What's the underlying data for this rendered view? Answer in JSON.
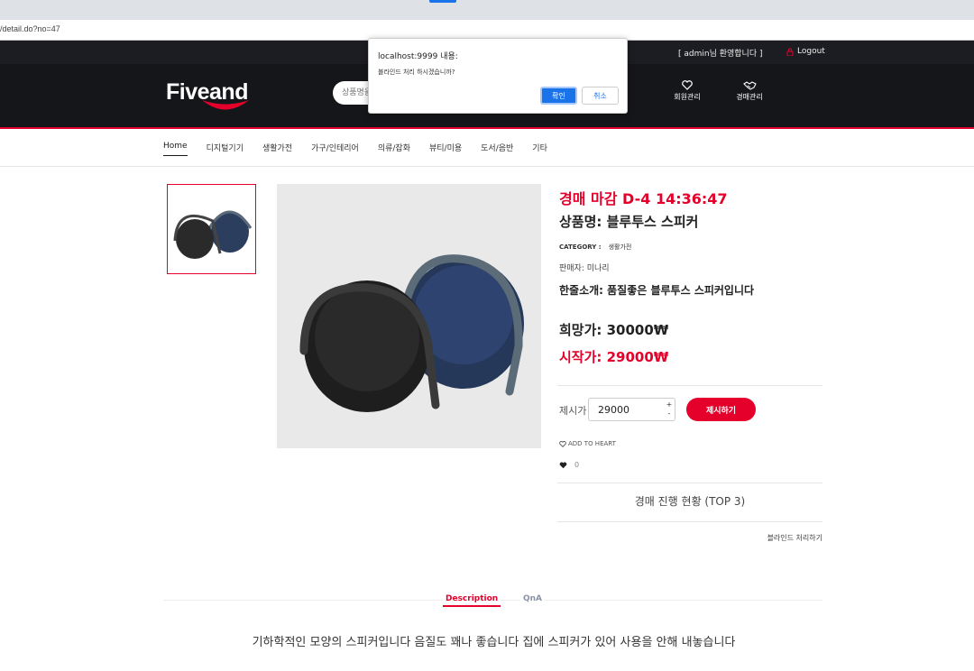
{
  "browser": {
    "url": "/detail.do?no=47"
  },
  "topbar": {
    "welcome": "[   admin님 환영합니다   ]",
    "logout": "Logout"
  },
  "header": {
    "logo": "Fiveand",
    "search_placeholder": "상품명을",
    "icons": [
      {
        "label": "회원관리",
        "icon": "heart-icon"
      },
      {
        "label": "경매관리",
        "icon": "handshake-icon"
      }
    ]
  },
  "nav": {
    "items": [
      "Home",
      "디지털기기",
      "생활가전",
      "가구/인테리어",
      "의류/잡화",
      "뷰티/미용",
      "도서/음반",
      "기타"
    ]
  },
  "product": {
    "deadline": "경매 마감 D-4 14:36:47",
    "name": "상품명: 블루투스 스피커",
    "category_label": "CATEGORY :",
    "category": "생활가전",
    "seller": "판매자: 미나리",
    "intro": "한줄소개: 품질좋은 블루투스 스피커입니다",
    "hope_price": "희망가: 30000₩",
    "start_price": "시작가: 29000₩"
  },
  "bid": {
    "label": "제시가",
    "value": "29000",
    "button": "제시하기",
    "heart_link": "ADD TO HEART",
    "likes": "0"
  },
  "auction_status": "경매 진행 현황 (TOP 3)",
  "blind_link": "블라인드 처리하기",
  "tabs": [
    "Description",
    "QnA"
  ],
  "description": "기하학적인 모양의 스피커입니다 음질도 꽤나 좋습니다 집에 스피커가 있어 사용을 안해 내놓습니다",
  "dialog": {
    "title": "localhost:9999 내용:",
    "message": "블라인드 처리 하시겠습니까?",
    "ok": "확인",
    "cancel": "취소"
  },
  "colors": {
    "accent": "#e4002b",
    "header_bg": "#15161a",
    "dialog_button": "#1a73e8"
  }
}
